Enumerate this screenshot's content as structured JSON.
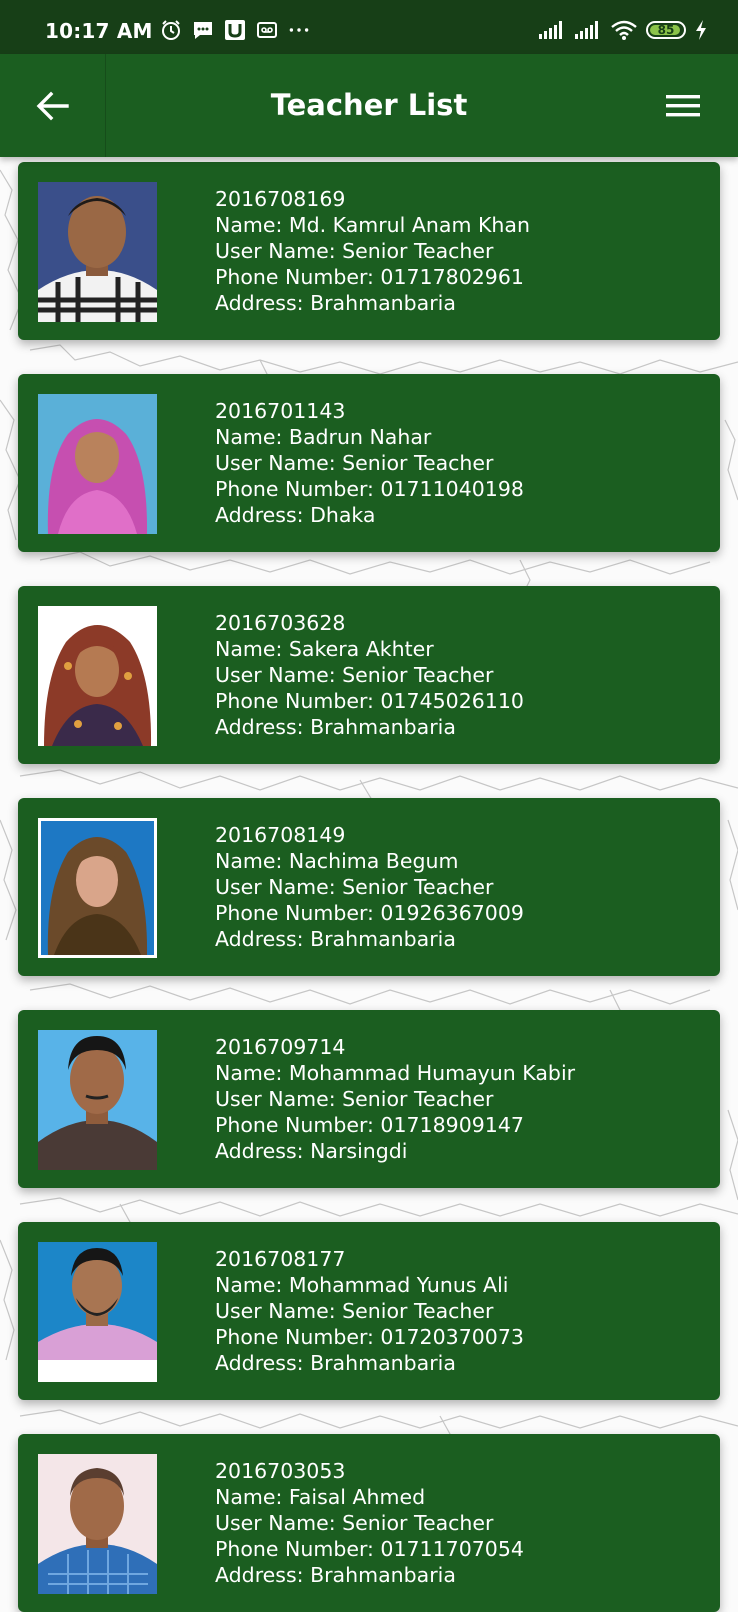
{
  "status_bar": {
    "time": "10:17 AM",
    "battery": "85"
  },
  "app_bar": {
    "title": "Teacher List"
  },
  "teachers": [
    {
      "id": "2016708169",
      "name": "Name: Md. Kamrul Anam Khan",
      "user_name": "User Name: Senior Teacher",
      "phone": "Phone Number: 01717802961",
      "address": "Address: Brahmanbaria"
    },
    {
      "id": "2016701143",
      "name": "Name: Badrun Nahar",
      "user_name": "User Name: Senior Teacher",
      "phone": "Phone Number: 01711040198",
      "address": "Address: Dhaka"
    },
    {
      "id": "2016703628",
      "name": "Name: Sakera Akhter",
      "user_name": "User Name: Senior Teacher",
      "phone": "Phone Number: 01745026110",
      "address": "Address: Brahmanbaria"
    },
    {
      "id": "2016708149",
      "name": "Name: Nachima Begum",
      "user_name": "User Name: Senior Teacher",
      "phone": "Phone Number: 01926367009",
      "address": "Address: Brahmanbaria"
    },
    {
      "id": "2016709714",
      "name": "Name: Mohammad Humayun Kabir",
      "user_name": "User Name: Senior Teacher",
      "phone": "Phone Number: 01718909147",
      "address": "Address: Narsingdi"
    },
    {
      "id": "2016708177",
      "name": "Name: Mohammad Yunus Ali",
      "user_name": "User Name: Senior Teacher",
      "phone": "Phone Number: 01720370073",
      "address": "Address: Brahmanbaria"
    },
    {
      "id": "2016703053",
      "name": "Name: Faisal Ahmed",
      "user_name": "User Name: Senior Teacher",
      "phone": "Phone Number: 01711707054",
      "address": "Address: Brahmanbaria"
    }
  ],
  "colors": {
    "status_bar": "#173f17",
    "app_bar": "#1b5e20",
    "card": "#1b5e20",
    "text": "#ffffff",
    "battery": "#8bc34a"
  },
  "icons": {
    "back": "arrow-left-icon",
    "menu": "hamburger-menu-icon",
    "alarm": "alarm-clock-icon",
    "message": "message-icon",
    "u_app": "u-app-icon",
    "voicemail": "voicemail-icon",
    "more": "more-dots-icon",
    "signal": "signal-icon",
    "wifi": "wifi-icon",
    "charging": "charging-bolt-icon"
  }
}
